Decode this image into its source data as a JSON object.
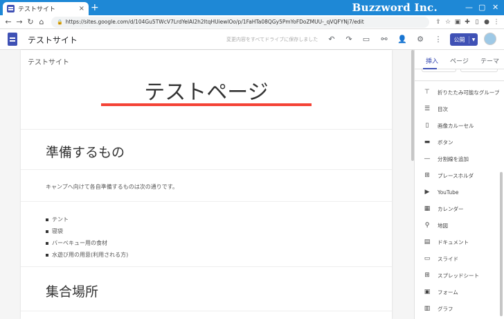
{
  "browser": {
    "tab_title": "テストサイト",
    "tab_close": "×",
    "new_tab": "+",
    "brand": "Buzzword Inc.",
    "url": "https://sites.google.com/d/104Gu5TWcV7LrdYeIAI2h2ltqHUiewlOo/p/1FaHTa08QGy5PmYoFDoZMUU-_qVQFYNj7/edit"
  },
  "toolbar": {
    "site_title": "テストサイト",
    "save_status": "変更内容をすべてドライブに保存しました",
    "publish_label": "公開"
  },
  "page": {
    "site_name": "テストサイト",
    "title": "テストページ",
    "section1_heading": "準備するもの",
    "section1_text": "キャンプへ向けて各自準備するものは次の通りです。",
    "list_items": [
      "テント",
      "寝袋",
      "バーベキュー用の食材",
      "水遊び用の用意(利用される方)"
    ],
    "section2_heading": "集合場所"
  },
  "panel": {
    "tabs": [
      "挿入",
      "ページ",
      "テーマ"
    ],
    "active_tab": "挿入",
    "items": [
      {
        "label": "折りたたみ可能なグループ",
        "icon": "collapsible-group-icon"
      },
      {
        "label": "目次",
        "icon": "table-of-contents-icon"
      },
      {
        "label": "画像カルーセル",
        "icon": "image-carousel-icon"
      },
      {
        "label": "ボタン",
        "icon": "button-icon"
      },
      {
        "label": "分割線を追加",
        "icon": "divider-icon"
      },
      {
        "label": "プレースホルダ",
        "icon": "placeholder-icon"
      },
      {
        "label": "YouTube",
        "icon": "youtube-icon"
      },
      {
        "label": "カレンダー",
        "icon": "calendar-icon"
      },
      {
        "label": "地図",
        "icon": "map-icon"
      },
      {
        "label": "ドキュメント",
        "icon": "docs-icon"
      },
      {
        "label": "スライド",
        "icon": "slides-icon"
      },
      {
        "label": "スプレッドシート",
        "icon": "sheets-icon"
      },
      {
        "label": "フォーム",
        "icon": "forms-icon"
      },
      {
        "label": "グラフ",
        "icon": "chart-icon"
      }
    ]
  },
  "colors": {
    "tabstrip": "#1e88d6",
    "accent": "#3f51b5",
    "title_underline": "#f44336"
  }
}
